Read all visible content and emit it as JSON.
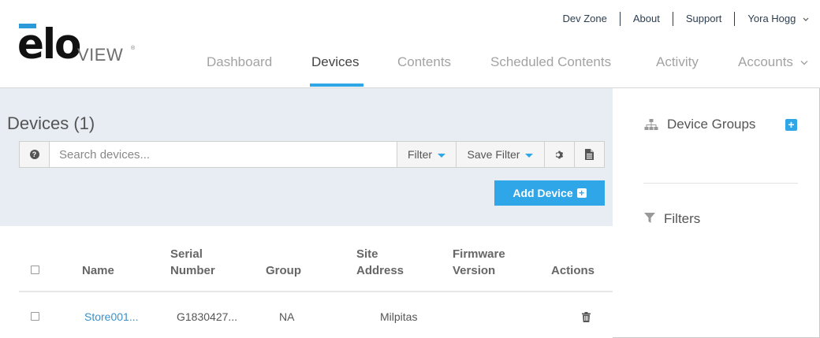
{
  "brand": {
    "logo_main": "elo",
    "logo_sub": "VIEW",
    "logo_tm": "®"
  },
  "utility_nav": {
    "dev_zone": "Dev Zone",
    "about": "About",
    "support": "Support",
    "user": "Yora Hogg"
  },
  "main_nav": {
    "dashboard": "Dashboard",
    "devices": "Devices",
    "contents": "Contents",
    "scheduled": "Scheduled Contents",
    "activity": "Activity",
    "accounts": "Accounts"
  },
  "devices_panel": {
    "title": "Devices (1)",
    "search": {
      "placeholder": "Search devices...",
      "value": ""
    },
    "filter_label": "Filter",
    "save_filter_label": "Save Filter",
    "add_device_label": "Add Device"
  },
  "table": {
    "columns": {
      "name": "Name",
      "serial_1": "Serial",
      "serial_2": "Number",
      "group": "Group",
      "site_1": "Site",
      "site_2": "Address",
      "firmware_1": "Firmware",
      "firmware_2": "Version",
      "actions": "Actions"
    },
    "rows": [
      {
        "name": "Store001...",
        "serial": "G1830427...",
        "group": "NA",
        "site": "Milpitas"
      }
    ]
  },
  "side_panel": {
    "device_groups": "Device Groups",
    "filters": "Filters"
  },
  "icons": {
    "help": "help-circle-icon",
    "gear": "gear-icon",
    "doc": "document-icon",
    "trash": "trash-icon",
    "sitemap": "sitemap-icon",
    "funnel": "funnel-icon",
    "plus": "plus-square-icon"
  },
  "colors": {
    "accent": "#2fa6e8",
    "panel_bg": "#e8ecf3",
    "link": "#3a90c8"
  }
}
